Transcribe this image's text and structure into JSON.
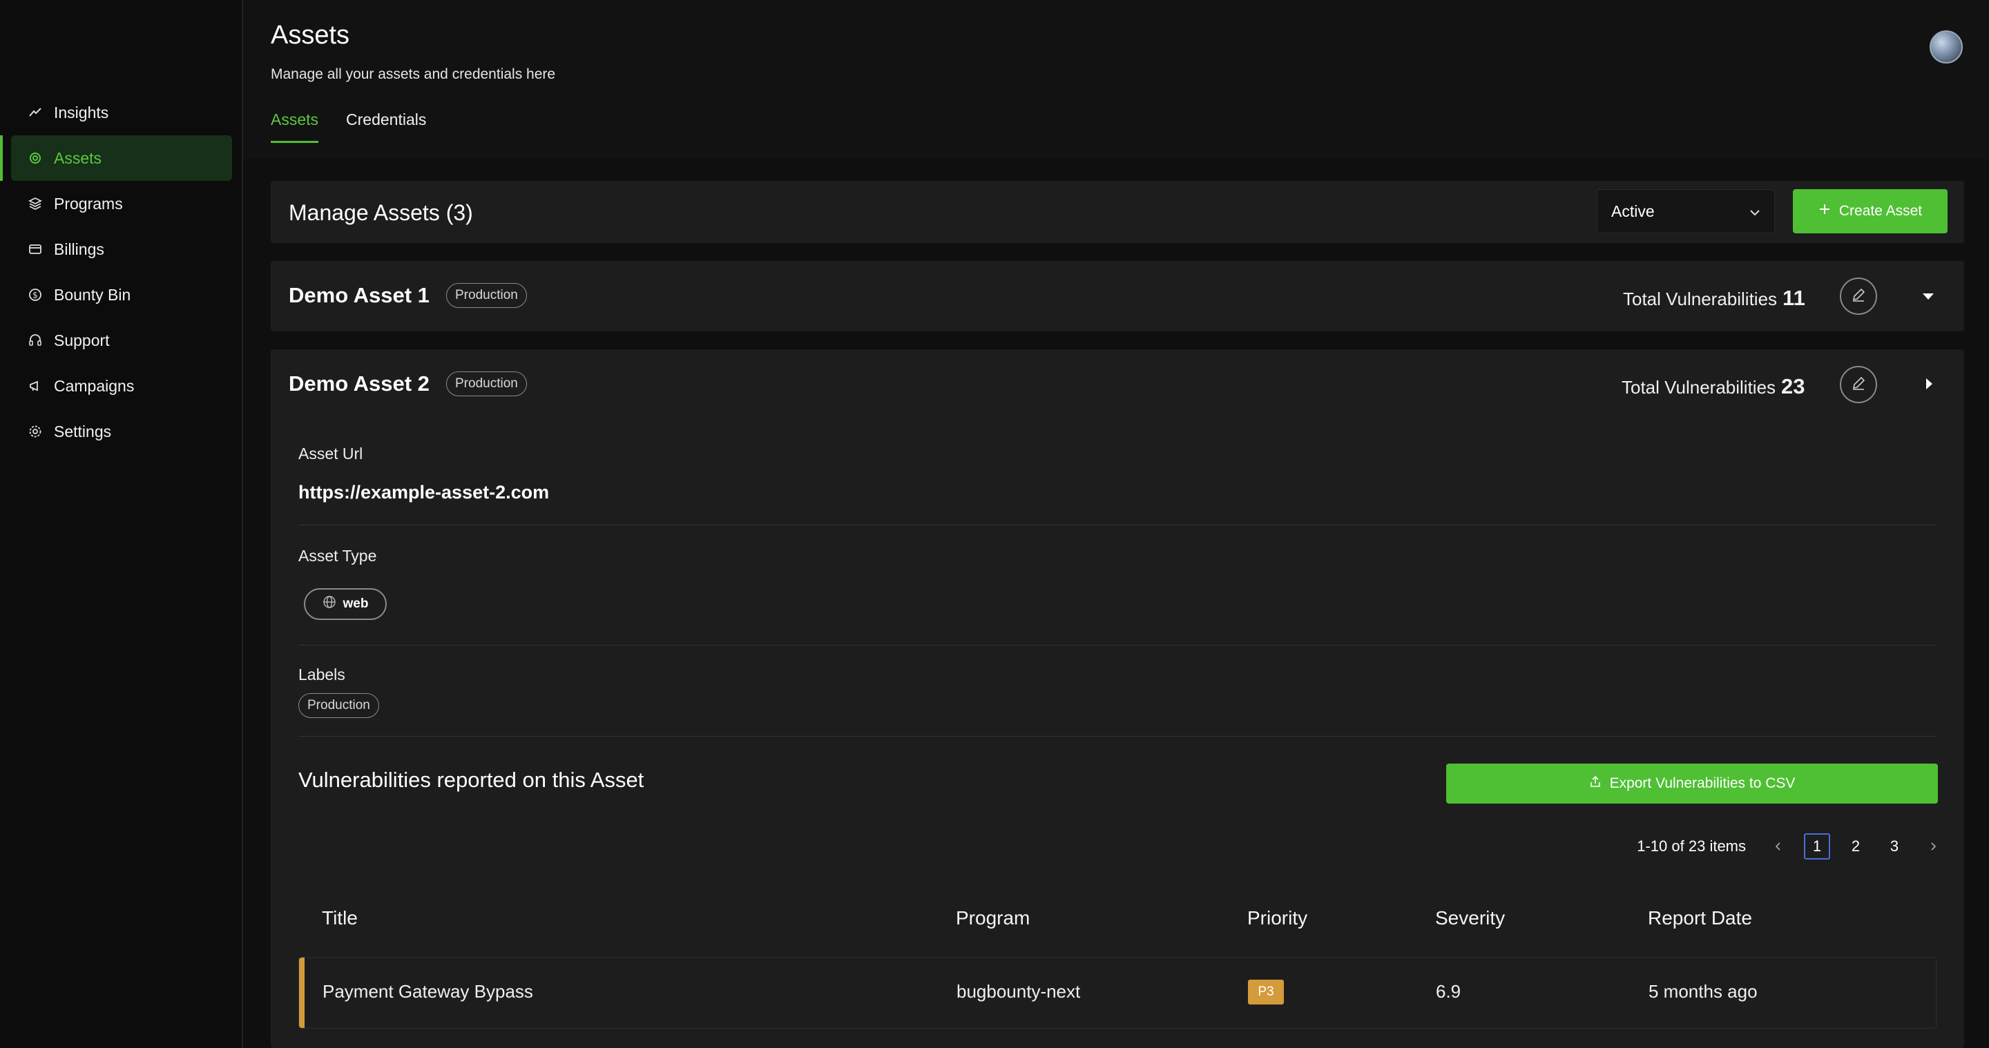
{
  "sidebar": {
    "items": [
      {
        "label": "Insights",
        "icon": "insights-icon"
      },
      {
        "label": "Assets",
        "icon": "assets-icon",
        "active": true
      },
      {
        "label": "Programs",
        "icon": "programs-icon"
      },
      {
        "label": "Billings",
        "icon": "billings-icon"
      },
      {
        "label": "Bounty Bin",
        "icon": "bounty-bin-icon"
      },
      {
        "label": "Support",
        "icon": "support-icon"
      },
      {
        "label": "Campaigns",
        "icon": "campaigns-icon"
      },
      {
        "label": "Settings",
        "icon": "settings-icon"
      }
    ]
  },
  "header": {
    "title": "Assets",
    "subtitle": "Manage all your assets and credentials here",
    "tabs": [
      {
        "label": "Assets",
        "active": true
      },
      {
        "label": "Credentials",
        "active": false
      }
    ]
  },
  "manage": {
    "title": "Manage Assets (3)",
    "status_select": "Active",
    "create_label": "Create Asset"
  },
  "assets": [
    {
      "name": "Demo Asset 1",
      "badge": "Production",
      "total_label": "Total Vulnerabilities",
      "total": "11"
    },
    {
      "name": "Demo Asset 2",
      "badge": "Production",
      "total_label": "Total Vulnerabilities",
      "total": "23",
      "url_label": "Asset Url",
      "url": "https://example-asset-2.com",
      "type_label": "Asset Type",
      "type": "web",
      "labels_label": "Labels",
      "labels": [
        "Production"
      ]
    }
  ],
  "vulns": {
    "title": "Vulnerabilities reported on this Asset",
    "export_label": "Export Vulnerabilities to CSV",
    "pagination": {
      "summary": "1-10 of 23 items",
      "pages": [
        "1",
        "2",
        "3"
      ],
      "current": "1"
    },
    "columns": [
      "Title",
      "Program",
      "Priority",
      "Severity",
      "Report Date"
    ],
    "rows": [
      {
        "title": "Payment Gateway Bypass",
        "program": "bugbounty-next",
        "priority": "P3",
        "severity": "6.9",
        "date": "5 months ago"
      }
    ]
  },
  "colors": {
    "accent": "#4fbf34",
    "priority_p3": "#d49b3a",
    "background": "#121212",
    "card": "#1d1d1d"
  }
}
